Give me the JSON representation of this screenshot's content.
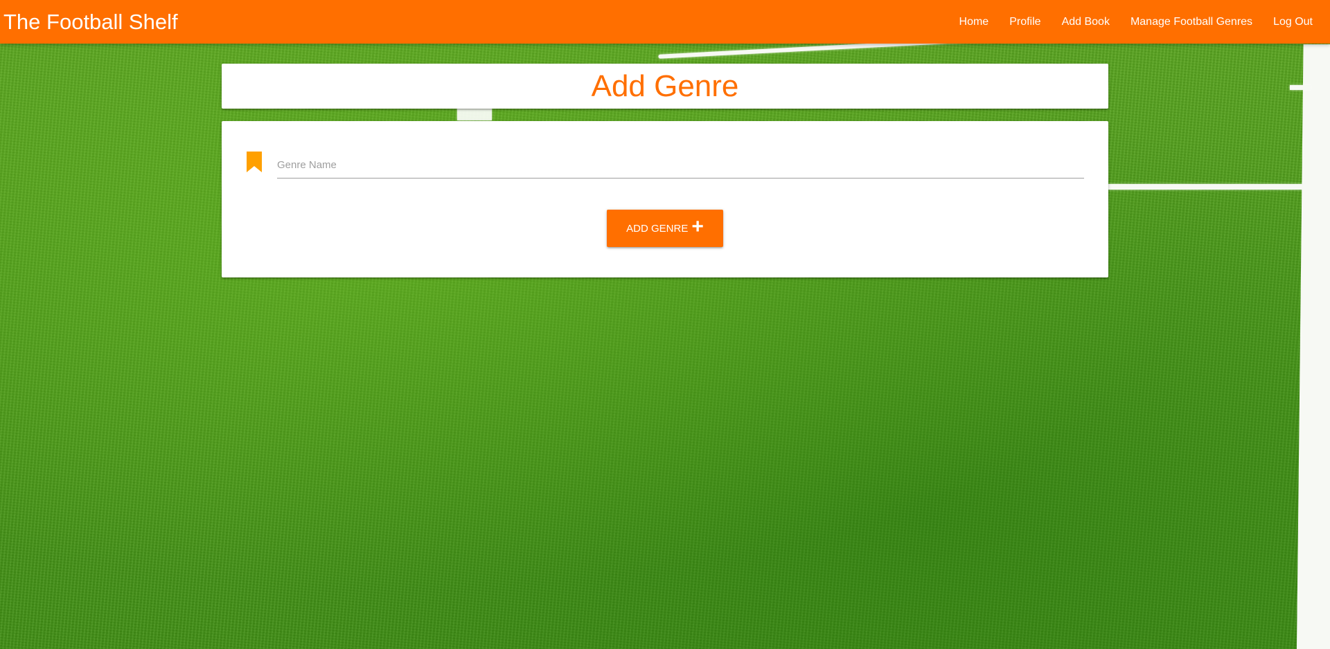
{
  "navbar": {
    "brand": "The Football Shelf",
    "links": [
      {
        "label": "Home"
      },
      {
        "label": "Profile"
      },
      {
        "label": "Add Book"
      },
      {
        "label": "Manage Football Genres"
      },
      {
        "label": "Log Out"
      }
    ],
    "background_color": "#ff6f00"
  },
  "page": {
    "title": "Add Genre",
    "title_color": "#ff6f00"
  },
  "form": {
    "field_icon": "bookmark-icon",
    "icon_color": "#ffa000",
    "genre_name": {
      "value": "",
      "placeholder": "Genre Name"
    },
    "submit_label": "Add Genre",
    "submit_icon": "plus-icon",
    "submit_icon_glyph": "+"
  },
  "background": {
    "theme": "football pitch grass",
    "grass_color": "#4c9a18"
  }
}
